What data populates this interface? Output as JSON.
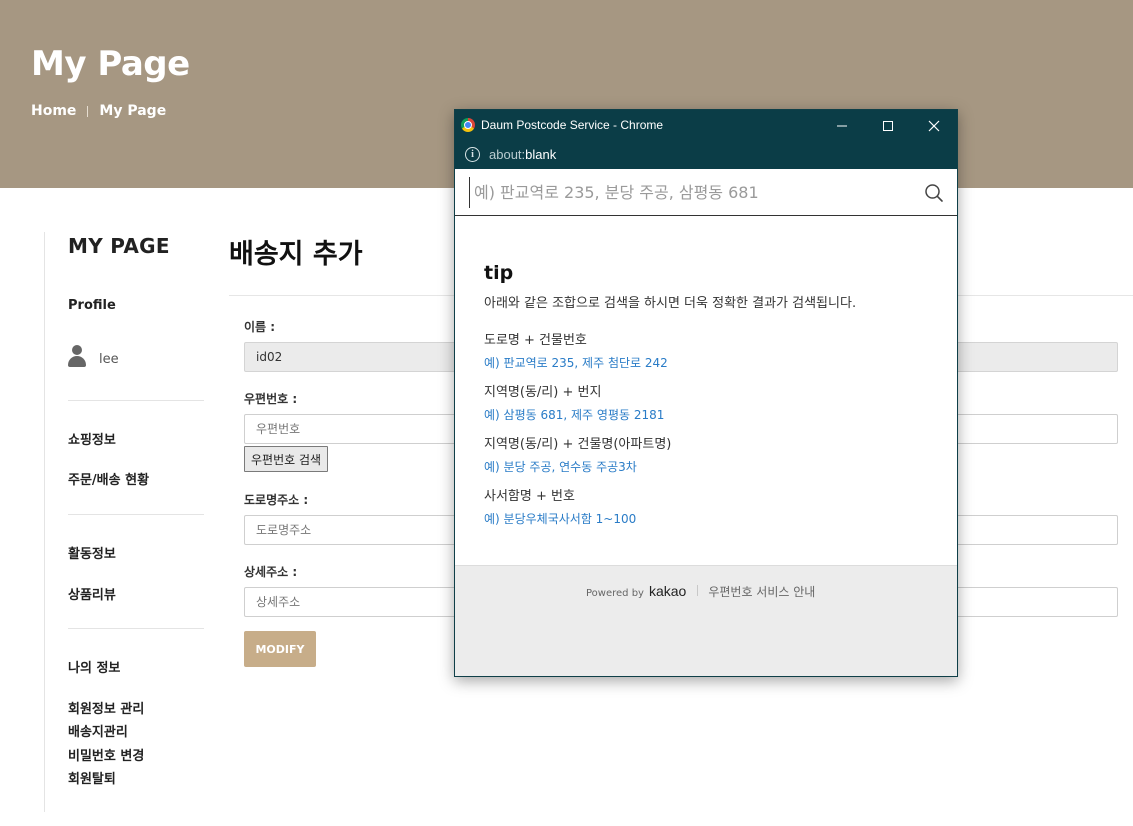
{
  "hero": {
    "title": "My Page",
    "breadcrumb": [
      "Home",
      "My Page"
    ]
  },
  "sidebar": {
    "title": "MY PAGE",
    "profile_heading": "Profile",
    "username": "lee",
    "sections": [
      {
        "heading": "쇼핑정보",
        "links": [
          "주문/배송 현황"
        ]
      },
      {
        "heading": "활동정보",
        "links": [
          "상품리뷰"
        ]
      },
      {
        "heading": "나의 정보",
        "links": [
          "회원정보 관리",
          "배송지관리",
          "비밀번호 변경",
          "회원탈퇴"
        ]
      }
    ]
  },
  "main": {
    "title": "배송지 추가",
    "fields": {
      "name": {
        "label": "이름 :",
        "value": "id02"
      },
      "zipcode": {
        "label": "우편번호 :",
        "placeholder": "우편번호",
        "button": "우편번호 검색"
      },
      "road_address": {
        "label": "도로명주소 :",
        "placeholder": "도로명주소"
      },
      "detail_address": {
        "label": "상세주소 :",
        "placeholder": "상세주소"
      }
    },
    "modify_button": "MODIFY"
  },
  "popup": {
    "window_title": "Daum Postcode Service - Chrome",
    "address_prefix": "about:",
    "address_main": "blank",
    "search_placeholder": "예) 판교역로 235, 분당 주공, 삼평동 681",
    "tip": {
      "title": "tip",
      "description": "아래와 같은 조합으로 검색을 하시면 더욱 정확한 결과가 검색됩니다.",
      "items": [
        {
          "head": "도로명 + 건물번호",
          "example": "예) 판교역로 235,  제주 첨단로 242"
        },
        {
          "head": "지역명(동/리) + 번지",
          "example": "예) 삼평동 681,  제주 영평동 2181"
        },
        {
          "head": "지역명(동/리) + 건물명(아파트명)",
          "example": "예) 분당 주공,  연수동 주공3차"
        },
        {
          "head": "사서함명 + 번호",
          "example": "예) 분당우체국사서함 1~100"
        }
      ]
    },
    "footer": {
      "powered_by": "Powered by",
      "brand": "kakao",
      "guide": "우편번호 서비스 안내"
    }
  },
  "colors": {
    "hero_bg": "#a69782",
    "modify_button": "#c7ad89",
    "popup_titlebar": "#0b3d47",
    "tip_example": "#2a7cc7"
  },
  "icons": [
    "user-avatar-icon",
    "chrome-logo-icon",
    "minimize-icon",
    "maximize-icon",
    "close-icon",
    "info-icon",
    "search-icon"
  ]
}
